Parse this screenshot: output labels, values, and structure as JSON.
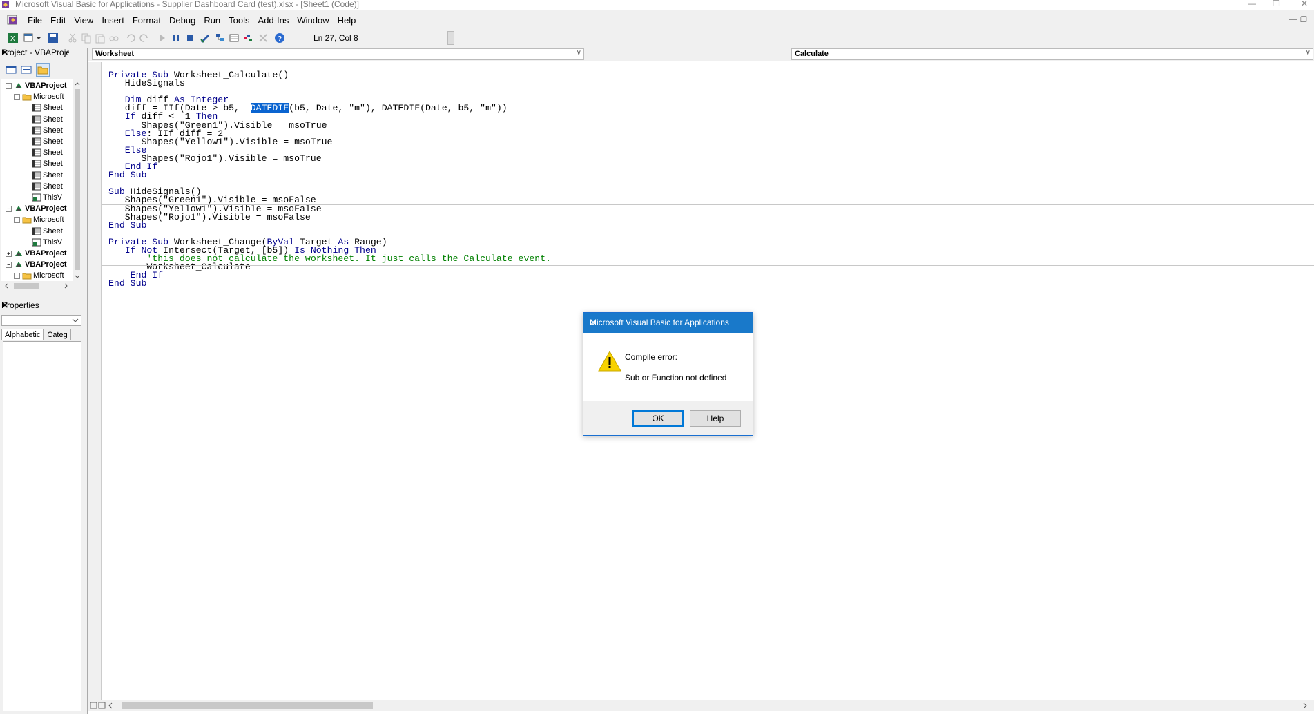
{
  "window": {
    "title": "Microsoft Visual Basic for Applications - Supplier Dashboard Card (test).xlsx - [Sheet1 (Code)]"
  },
  "menu": [
    "File",
    "Edit",
    "View",
    "Insert",
    "Format",
    "Debug",
    "Run",
    "Tools",
    "Add-Ins",
    "Window",
    "Help"
  ],
  "toolbar": {
    "cursor_position": "Ln 27, Col 8"
  },
  "project": {
    "title": "Project - VBAProject",
    "tree": [
      {
        "label": "VBAProject",
        "kind": "project"
      },
      {
        "label": "Microsoft",
        "kind": "folder"
      },
      {
        "label": "Sheet",
        "kind": "sheet"
      },
      {
        "label": "Sheet",
        "kind": "sheet"
      },
      {
        "label": "Sheet",
        "kind": "sheet"
      },
      {
        "label": "Sheet",
        "kind": "sheet"
      },
      {
        "label": "Sheet",
        "kind": "sheet"
      },
      {
        "label": "Sheet",
        "kind": "sheet"
      },
      {
        "label": "Sheet",
        "kind": "sheet"
      },
      {
        "label": "Sheet",
        "kind": "sheet"
      },
      {
        "label": "ThisV",
        "kind": "workbook"
      },
      {
        "label": "VBAProject",
        "kind": "project"
      },
      {
        "label": "Microsoft",
        "kind": "folder"
      },
      {
        "label": "Sheet",
        "kind": "sheet"
      },
      {
        "label": "ThisV",
        "kind": "workbook"
      },
      {
        "label": "VBAProject",
        "kind": "project"
      },
      {
        "label": "VBAProject",
        "kind": "project"
      },
      {
        "label": "Microsoft",
        "kind": "folder"
      }
    ]
  },
  "properties": {
    "title": "Properties",
    "tabs": [
      "Alphabetic",
      "Categ"
    ]
  },
  "code_window": {
    "object_combo": "Worksheet",
    "procedure_combo": "Calculate",
    "blocks": [
      [
        [
          {
            "t": "Private Sub ",
            "c": "kw"
          },
          {
            "t": "Worksheet_Calculate()"
          }
        ],
        [
          {
            "t": "   HideSignals"
          }
        ],
        [
          {
            "t": ""
          }
        ],
        [
          {
            "t": "   "
          },
          {
            "t": "Dim ",
            "c": "kw"
          },
          {
            "t": "diff "
          },
          {
            "t": "As Integer",
            "c": "kw"
          }
        ],
        [
          {
            "t": "   diff = IIf(Date > b5, -"
          },
          {
            "t": "DATEDIF",
            "c": "sel"
          },
          {
            "t": "(b5, Date, \"m\"), DATEDIF(Date, b5, \"m\"))"
          }
        ],
        [
          {
            "t": "   "
          },
          {
            "t": "If ",
            "c": "kw"
          },
          {
            "t": "diff <= 1 "
          },
          {
            "t": "Then",
            "c": "kw"
          }
        ],
        [
          {
            "t": "      Shapes(\"Green1\").Visible = msoTrue"
          }
        ],
        [
          {
            "t": "   "
          },
          {
            "t": "Else",
            "c": "kw"
          },
          {
            "t": ": IIf diff = 2"
          }
        ],
        [
          {
            "t": "      Shapes(\"Yellow1\").Visible = msoTrue"
          }
        ],
        [
          {
            "t": "   "
          },
          {
            "t": "Else",
            "c": "kw"
          }
        ],
        [
          {
            "t": "      Shapes(\"Rojo1\").Visible = msoTrue"
          }
        ],
        [
          {
            "t": "   "
          },
          {
            "t": "End If",
            "c": "kw"
          }
        ],
        [
          {
            "t": "End Sub",
            "c": "kw"
          }
        ]
      ],
      [
        [
          {
            "t": "Sub ",
            "c": "kw"
          },
          {
            "t": "HideSignals()"
          }
        ],
        [
          {
            "t": "   Shapes(\"Green1\").Visible = msoFalse"
          }
        ],
        [
          {
            "t": "   Shapes(\"Yellow1\").Visible = msoFalse"
          }
        ],
        [
          {
            "t": "   Shapes(\"Rojo1\").Visible = msoFalse"
          }
        ],
        [
          {
            "t": "End Sub",
            "c": "kw"
          }
        ]
      ],
      [
        [
          {
            "t": "Private Sub ",
            "c": "kw"
          },
          {
            "t": "Worksheet_Change("
          },
          {
            "t": "ByVal ",
            "c": "kw"
          },
          {
            "t": "Target "
          },
          {
            "t": "As ",
            "c": "kw"
          },
          {
            "t": "Range)"
          }
        ],
        [
          {
            "t": "   "
          },
          {
            "t": "If Not ",
            "c": "kw"
          },
          {
            "t": "Intersect(Target, [b5]) "
          },
          {
            "t": "Is Nothing Then",
            "c": "kw"
          }
        ],
        [
          {
            "t": "       "
          },
          {
            "t": "'this does not calculate the worksheet. It just calls the Calculate event.",
            "c": "cm"
          }
        ],
        [
          {
            "t": "       Worksheet_Calculate"
          }
        ],
        [
          {
            "t": "    "
          },
          {
            "t": "End If",
            "c": "kw"
          }
        ],
        [
          {
            "t": "End Sub",
            "c": "kw"
          }
        ]
      ]
    ]
  },
  "dialog": {
    "title": "Microsoft Visual Basic for Applications",
    "line1": "Compile error:",
    "line2": "Sub or Function not defined",
    "ok_label": "OK",
    "help_label": "Help"
  }
}
